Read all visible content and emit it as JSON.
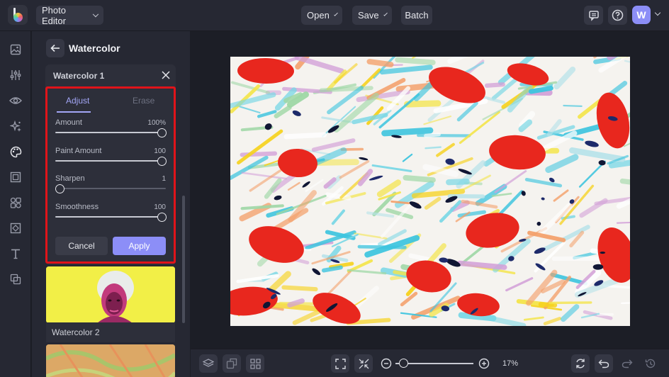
{
  "header": {
    "app_menu_label": "Photo Editor",
    "open_label": "Open",
    "save_label": "Save",
    "batch_label": "Batch",
    "avatar_initial": "W"
  },
  "panel": {
    "title": "Watercolor",
    "card": {
      "title": "Watercolor 1",
      "tabs": [
        {
          "label": "Adjust",
          "active": true
        },
        {
          "label": "Erase",
          "active": false
        }
      ],
      "sliders": [
        {
          "label": "Amount",
          "value_text": "100%",
          "fraction": 1.0
        },
        {
          "label": "Paint Amount",
          "value_text": "100",
          "fraction": 1.0
        },
        {
          "label": "Sharpen",
          "value_text": "1",
          "fraction": 0.0
        },
        {
          "label": "Smoothness",
          "value_text": "100",
          "fraction": 1.0
        }
      ],
      "cancel_label": "Cancel",
      "apply_label": "Apply"
    },
    "presets": [
      {
        "label": "Watercolor 2"
      }
    ]
  },
  "bottom": {
    "zoom_text": "17%",
    "zoom_fraction": 0.05
  },
  "colors": {
    "accent": "#8c8ef7",
    "highlight_box": "#e0141a",
    "background": "#1c1e26",
    "panel": "#262833"
  },
  "icons": {
    "rail": [
      "image-icon",
      "sliders-icon",
      "eye-icon",
      "sparkle-icon",
      "palette-icon",
      "frame-icon",
      "shapes-icon",
      "texture-icon",
      "text-icon",
      "overlay-icon"
    ],
    "top_right": [
      "comment-icon",
      "help-icon"
    ],
    "bottom": [
      "layers-icon",
      "replace-icon",
      "grid-icon",
      "fit-screen-icon",
      "actual-size-icon",
      "zoom-out-icon",
      "zoom-in-icon",
      "reset-icon",
      "undo-icon",
      "redo-icon",
      "history-icon"
    ]
  }
}
